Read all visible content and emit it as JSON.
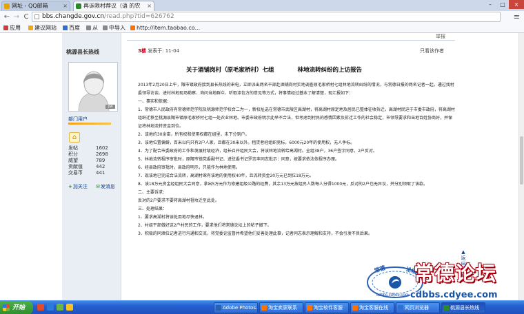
{
  "browser": {
    "tabs": [
      {
        "label": "网址 - QQ邮箱",
        "color": "#e6a400"
      },
      {
        "label": "再诉限村荐议（语 的农",
        "color": "#2a8a2a"
      }
    ],
    "window_buttons": {
      "minimize": "–",
      "maximize": "□",
      "close": "×"
    },
    "nav": {
      "back": "←",
      "forward": "→",
      "reload": "C"
    },
    "url_host": "bbs.changde.gov.cn",
    "url_path": "/read.php?tid=626762",
    "menu_glyph": "≡",
    "bookmarks": [
      {
        "label": "应用",
        "color": "#d23b3b"
      },
      {
        "label": "建议网站",
        "color": "#f3a81a"
      },
      {
        "label": "百度",
        "color": "#2f6fd6"
      },
      {
        "label": "从",
        "color": "#888888"
      },
      {
        "label": "中导入",
        "color": "#888888"
      },
      {
        "label": "http://item.taobao.co...",
        "color": "#ff7200"
      }
    ]
  },
  "forum": {
    "previous_post_tail": "举报",
    "author": {
      "name": "桃源县长热线",
      "avatar_badge": "pw",
      "group": "部门用户",
      "stats": [
        {
          "label": "发帖",
          "value": "1602"
        },
        {
          "label": "积分",
          "value": "2698"
        },
        {
          "label": "威望",
          "value": "789"
        },
        {
          "label": "贡献值",
          "value": "442"
        },
        {
          "label": "交易币",
          "value": "441"
        }
      ],
      "follow_label": "加关注",
      "message_label": "发消息"
    },
    "post": {
      "floor": "3楼",
      "posted_at": "发表于: 11-04",
      "only_author": "只看该作者",
      "title": "关于酒铺岗村（原毛家桥村）七组　　　　林地流转纠纷的上访报告",
      "paragraphs": [
        "2013年2月20日上午，陬市镇政府接到县长热线的来电，立即派出两名干部赴酒铺岗村实地调查原毛家桥村七组林地流转纠纷的情况，与常德日报的两名记者一起，通过找村委领导访谈、进村林地现场勘察、询问当地群众、听取涤包方的意见等方式，将事情经过基本了解清楚，现汇报如下：",
        "一、事实和依据：",
        "1、常德市人民政府有常德师范学院及桃源师范学校合二为一，新校址选在常德市武陵区高湖村，将高湖村原定地及居民已整体征收拆迁。高湖村民迫于市委市政府，将高湖村组织迁移至桃源县陬市镇原毛家桥村七组一处农业林地。市委市政府明示此举不合法，但考虑到村民的感情因素及拆迁工作的社会稳定，市领导要求和当地百姓协商好，并保证将林地流转资金到位。",
        "2、该地约30余亩，所有权和使用权都在组里，未下分到户。",
        "3、该地位置偏僻，百米以内只有2户人家，且都在30米以外。租赁者经组织竞标，6000元20年的使用权，无人争标。",
        "4、为了配合市委政府的工作和发展村级经济，组长召开组民大会，将该林地流转给高湖村。全组38户，36户签字同意，2户反对。",
        "5、林地流转程序审批时，原陬市镇党委副书记、进驻委书记罗志丰同志批示：同意，按要求依法依程序办理。",
        "6、经县政府审批时，县政府明示，只能作为林地使用。",
        "7、现该地已完成合法流转，高湖村琢有该地的使用权40年，且流转资金20万元已到位18万元。",
        "8、该18万元资金经组民大会同意，拿出5万元作为修建组级公路的经费，其余13万元按组民人数每人分得1000元，反对的2户也无异议，并分別领取了该款。",
        "二、主要诉求：",
        "反对的2户要求不要将高湖村祖坟迁至此处。",
        "三、处理结果：",
        "1、要求高湖村将该处用地尽快退林。",
        "2、村组干部做好这2户村民的工作，要求他们将常德论坛上的帖子撤下。",
        "3、积极的同酒位记者进行沟通和交流，将党委论监督并希望他们妥善处理此事，记者同志表示理解和支持，不会引发不良后果。"
      ]
    },
    "back_to_top": "返回顶部",
    "back_to_top_arrow": "▲"
  },
  "watermark": {
    "logo_text": "常德论坛",
    "logo_url": "cdbbs.cdyee.com",
    "title": "常德论坛",
    "url": "cdbbs.cdyee.com"
  },
  "taskbar": {
    "start_label": "开始",
    "quick_launch": [
      "#e54b2a",
      "#2b7bdb",
      "#6cb543",
      "#f7c31c"
    ],
    "items": [
      {
        "label": "Adobe Photos...",
        "color": "#2b5fb0"
      },
      {
        "label": "淘宝卖家联系",
        "color": "#ff7200"
      },
      {
        "label": "淘宝软件客服",
        "color": "#ff7200"
      },
      {
        "label": "淘宝客服在线",
        "color": "#ff7200"
      },
      {
        "label": "网页浏览器",
        "color": "#2f6fd6"
      },
      {
        "label": "桃源县长热线",
        "color": "#2a8a2a"
      }
    ]
  }
}
